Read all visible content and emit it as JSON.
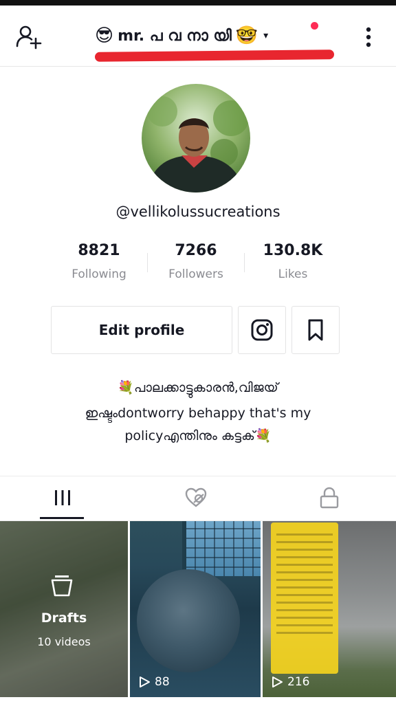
{
  "header": {
    "title": "mr. പ വ നാ യി",
    "left_emoji": "😎",
    "right_emoji": "🤓",
    "caret": "▾"
  },
  "profile": {
    "username": "@vellikolussucreations"
  },
  "stats": [
    {
      "value": "8821",
      "label": "Following"
    },
    {
      "value": "7266",
      "label": "Followers"
    },
    {
      "value": "130.8K",
      "label": "Likes"
    }
  ],
  "actions": {
    "edit_profile_label": "Edit profile"
  },
  "bio": {
    "line1": "💐പാലക്കാട്ടുകാരൻ,വിജയ്",
    "line2": "ഇഷ്ടംdontworry behappy that's my",
    "line3": "policyഎന്തിനും കട്ടക്💐"
  },
  "tabs": [
    {
      "icon": "grid-icon",
      "active": true
    },
    {
      "icon": "liked-hidden-icon",
      "active": false
    },
    {
      "icon": "lock-icon",
      "active": false
    }
  ],
  "videos": [
    {
      "type": "drafts",
      "title": "Drafts",
      "count_label": "10 videos"
    },
    {
      "type": "video",
      "views": "88"
    },
    {
      "type": "video",
      "views": "216"
    }
  ],
  "colors": {
    "accent": "#fe2c55",
    "annotation_underline": "#e8262f",
    "text_primary": "#161823",
    "text_secondary": "#8a8b91"
  }
}
